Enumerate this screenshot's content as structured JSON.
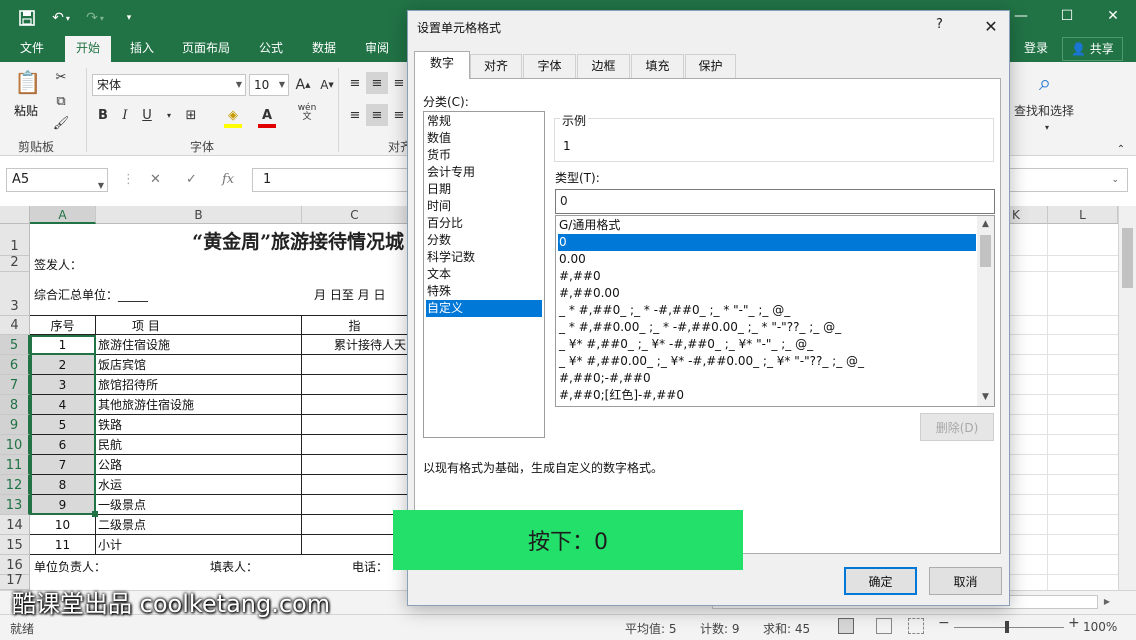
{
  "excel": {
    "quick_access": {
      "save_icon": "save-icon",
      "undo_icon": "undo-icon",
      "redo_icon": "redo-icon"
    },
    "ribbon_tabs": [
      "文件",
      "开始",
      "插入",
      "页面布局",
      "公式",
      "数据",
      "审阅"
    ],
    "active_tab": "开始",
    "login": "登录",
    "share": "共享",
    "ribbon": {
      "paste_label": "粘贴",
      "clipboard_label": "剪贴板",
      "font_name": "宋体",
      "font_size": "10",
      "font_group_label": "字体",
      "align_group_label": "对齐",
      "bold": "B",
      "italic": "I",
      "underline": "U",
      "find_label": "查找和选择",
      "wen_label": "wén"
    },
    "name_box": "A5",
    "formula_value": "1",
    "fx_symbol": "fx",
    "columns": [
      "A",
      "B",
      "C",
      "K",
      "L"
    ],
    "rows": [
      "1",
      "2",
      "3",
      "4",
      "5",
      "6",
      "7",
      "8",
      "9",
      "10",
      "11",
      "12",
      "13",
      "14",
      "15",
      "16",
      "17"
    ],
    "sheet": {
      "title": "“黄金周”旅游接待情况城",
      "signer": "签发人：",
      "summary_unit": "综合汇总单位：_____",
      "date_range": "月  日至  月  日",
      "header_seq": "序号",
      "header_item": "项                目",
      "header_index": "指",
      "cumulative_label": "累计接待人天",
      "items": [
        {
          "seq": "1",
          "name": "旅游住宿设施"
        },
        {
          "seq": "2",
          "name": "饭店宾馆"
        },
        {
          "seq": "3",
          "name": "旅馆招待所"
        },
        {
          "seq": "4",
          "name": "其他旅游住宿设施"
        },
        {
          "seq": "5",
          "name": "铁路"
        },
        {
          "seq": "6",
          "name": "民航"
        },
        {
          "seq": "7",
          "name": "公路"
        },
        {
          "seq": "8",
          "name": "水运"
        },
        {
          "seq": "9",
          "name": "一级景点"
        },
        {
          "seq": "10",
          "name": "二级景点"
        },
        {
          "seq": "11",
          "name": "小计"
        }
      ],
      "footer_unit_head": "单位负责人：",
      "footer_filler": "填表人：",
      "footer_phone": "电话："
    },
    "status": {
      "ready": "就绪",
      "average": "平均值: 5",
      "count": "计数: 9",
      "sum": "求和: 45",
      "zoom": "100%"
    }
  },
  "dialog": {
    "title": "设置单元格格式",
    "help": "?",
    "tabs": [
      "数字",
      "对齐",
      "字体",
      "边框",
      "填充",
      "保护"
    ],
    "active_tab": "数字",
    "category_label": "分类(C):",
    "categories": [
      "常规",
      "数值",
      "货币",
      "会计专用",
      "日期",
      "时间",
      "百分比",
      "分数",
      "科学记数",
      "文本",
      "特殊",
      "自定义"
    ],
    "selected_category": "自定义",
    "sample_label": "示例",
    "sample_value": "1",
    "type_label": "类型(T):",
    "type_value": "0",
    "format_list": [
      "G/通用格式",
      "0",
      "0.00",
      "#,##0",
      "#,##0.00",
      "_ * #,##0_ ;_ * -#,##0_ ;_ * \"-\"_ ;_ @_",
      "_ * #,##0.00_ ;_ * -#,##0.00_ ;_ * \"-\"??_ ;_ @_",
      "_ ¥* #,##0_ ;_ ¥* -#,##0_ ;_ ¥* \"-\"_ ;_ @_",
      "_ ¥* #,##0.00_ ;_ ¥* -#,##0.00_ ;_ ¥* \"-\"??_ ;_ @_",
      "#,##0;-#,##0",
      "#,##0;[红色]-#,##0"
    ],
    "selected_format": "0",
    "delete_label": "删除(D)",
    "description": "以现有格式为基础，生成自定义的数字格式。",
    "ok_label": "确定",
    "cancel_label": "取消"
  },
  "overlay": {
    "key_toast": "按下：0",
    "watermark": "酷课堂出品 coolketang.com"
  },
  "colors": {
    "excel_green": "#217346",
    "selection_blue": "#0078d7",
    "toast_green": "#23e06a"
  }
}
